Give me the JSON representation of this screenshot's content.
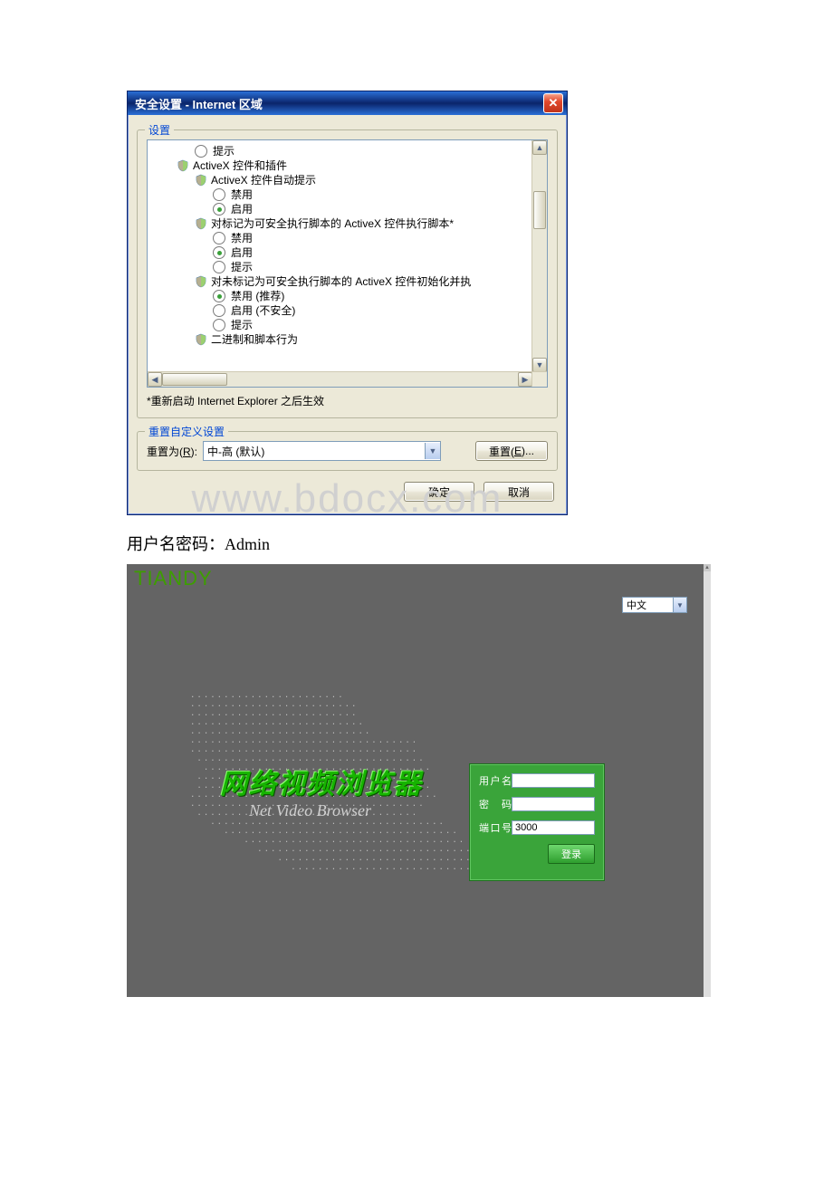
{
  "dialog": {
    "title": "安全设置 - Internet 区域",
    "settings_legend": "设置",
    "tree": [
      {
        "level": 1,
        "type": "radio",
        "selected": false,
        "label": "提示"
      },
      {
        "level": 2,
        "type": "category",
        "label": "ActiveX 控件和插件"
      },
      {
        "level": 3,
        "type": "category",
        "label": "ActiveX 控件自动提示"
      },
      {
        "level": 4,
        "type": "radio",
        "selected": false,
        "label": "禁用"
      },
      {
        "level": 4,
        "type": "radio",
        "selected": true,
        "label": "启用"
      },
      {
        "level": 3,
        "type": "category",
        "label": "对标记为可安全执行脚本的 ActiveX 控件执行脚本*"
      },
      {
        "level": 4,
        "type": "radio",
        "selected": false,
        "label": "禁用"
      },
      {
        "level": 4,
        "type": "radio",
        "selected": true,
        "label": "启用"
      },
      {
        "level": 4,
        "type": "radio",
        "selected": false,
        "label": "提示"
      },
      {
        "level": 3,
        "type": "category",
        "label": "对未标记为可安全执行脚本的 ActiveX 控件初始化并执"
      },
      {
        "level": 4,
        "type": "radio",
        "selected": true,
        "label": "禁用 (推荐)"
      },
      {
        "level": 4,
        "type": "radio",
        "selected": false,
        "label": "启用 (不安全)"
      },
      {
        "level": 4,
        "type": "radio",
        "selected": false,
        "label": "提示"
      },
      {
        "level": 3,
        "type": "category",
        "label": "二进制和脚本行为"
      }
    ],
    "footnote": "*重新启动 Internet Explorer 之后生效",
    "reset_legend": "重置自定义设置",
    "reset_label_pre": "重置为(",
    "reset_label_u": "R",
    "reset_label_post": "):",
    "reset_combo_value": "中-高 (默认)",
    "reset_btn_pre": "重置(",
    "reset_btn_u": "E",
    "reset_btn_post": ")...",
    "ok_label": "确定",
    "cancel_label": "取消"
  },
  "watermark": "www.bdocx.com",
  "caption": "用户名密码：Admin",
  "login": {
    "brand": "TIANDY",
    "lang_value": "中文",
    "hero_title": "网络视频浏览器",
    "hero_sub": "Net Video Browser",
    "user_label": "用户名",
    "user_value": "",
    "pass_label": "密 码",
    "pass_value": "",
    "port_label": "端口号",
    "port_value": "3000",
    "login_btn": "登录"
  }
}
